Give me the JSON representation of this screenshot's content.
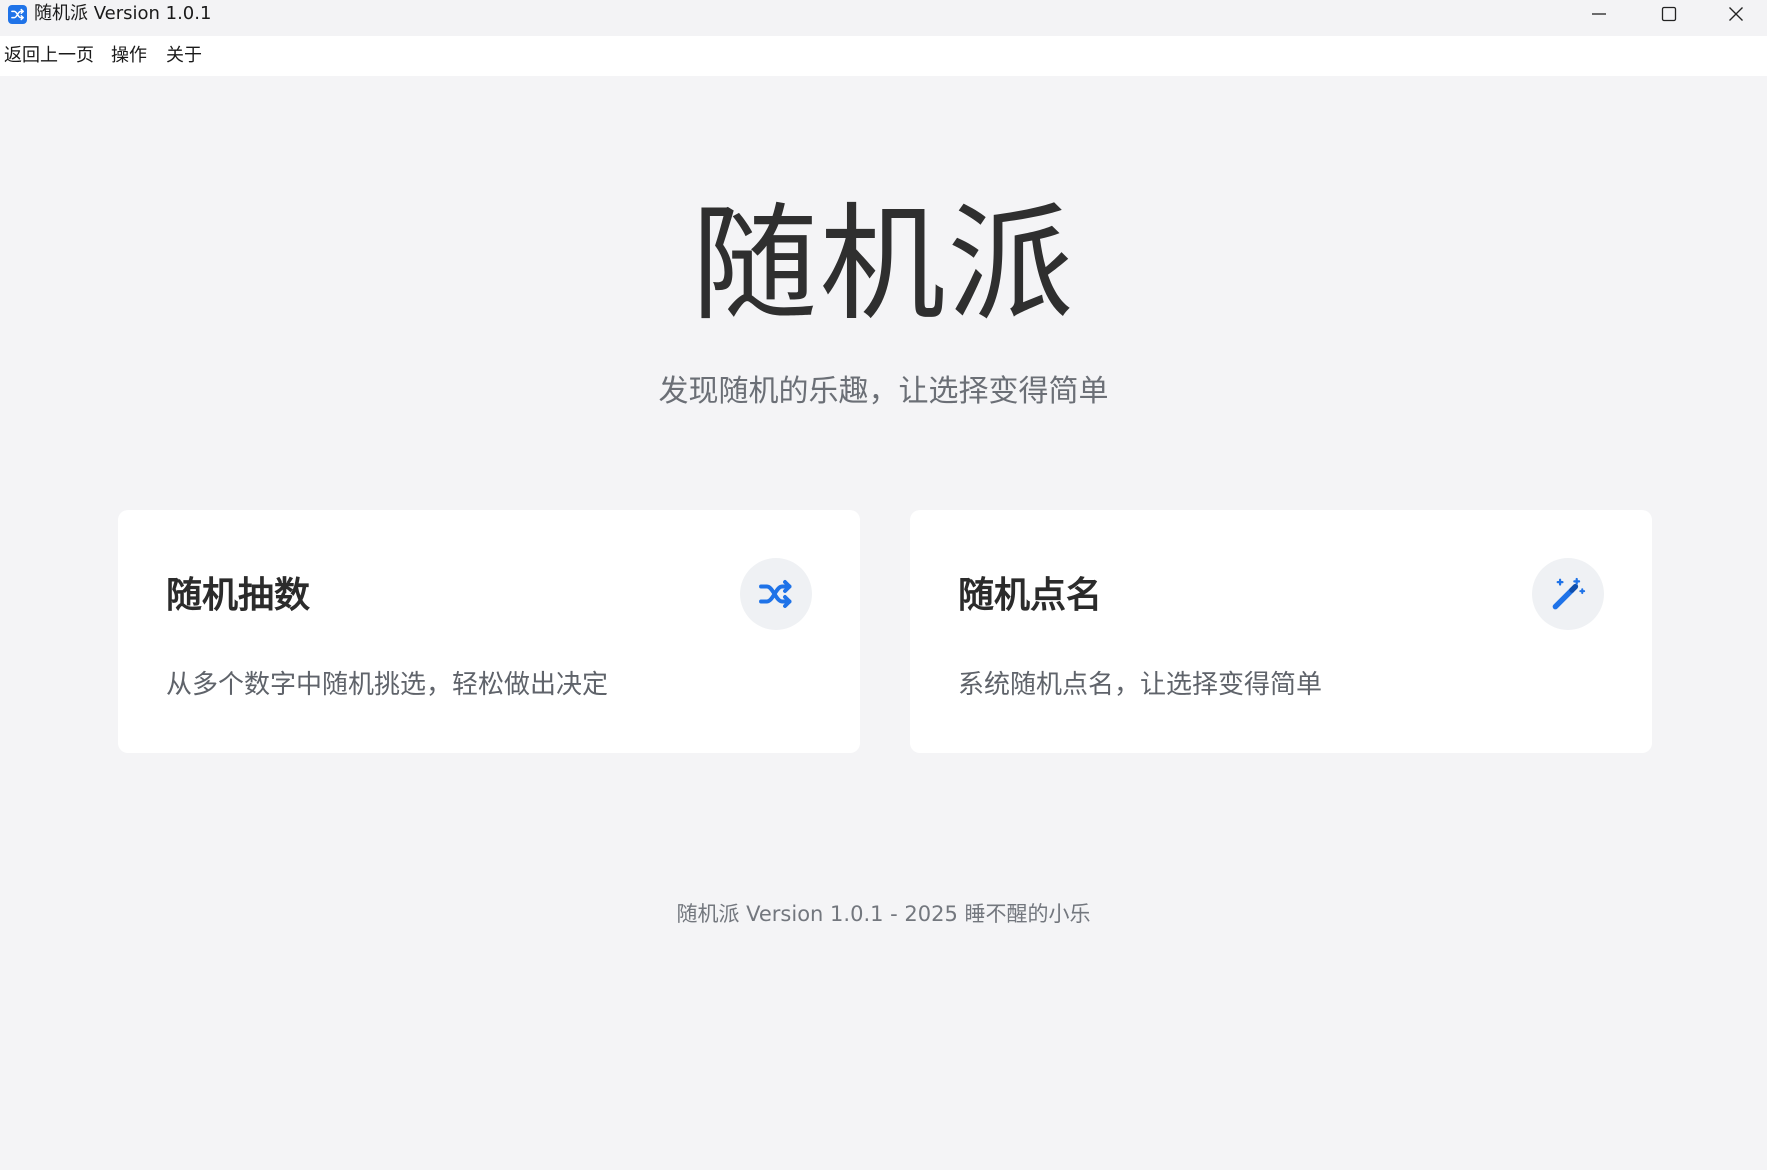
{
  "window": {
    "title": "随机派 Version 1.0.1",
    "icon": "shuffle-icon",
    "controls": [
      "minimize-icon",
      "maximize-icon",
      "close-icon"
    ]
  },
  "menu": {
    "back": "返回上一页",
    "operations": "操作",
    "about": "关于"
  },
  "hero": {
    "title": "随机派",
    "subtitle": "发现随机的乐趣，让选择变得简单"
  },
  "cards": [
    {
      "title": "随机抽数",
      "description": "从多个数字中随机挑选，轻松做出决定",
      "icon": "shuffle-icon"
    },
    {
      "title": "随机点名",
      "description": "系统随机点名，让选择变得简单",
      "icon": "magic-wand-icon"
    }
  ],
  "footer": {
    "text": "随机派 Version 1.0.1 - 2025 睡不醒的小乐"
  },
  "colors": {
    "accent": "#1f73e8",
    "background": "#f4f4f6",
    "card": "#ffffff",
    "icon_bg": "#eff1f4"
  }
}
